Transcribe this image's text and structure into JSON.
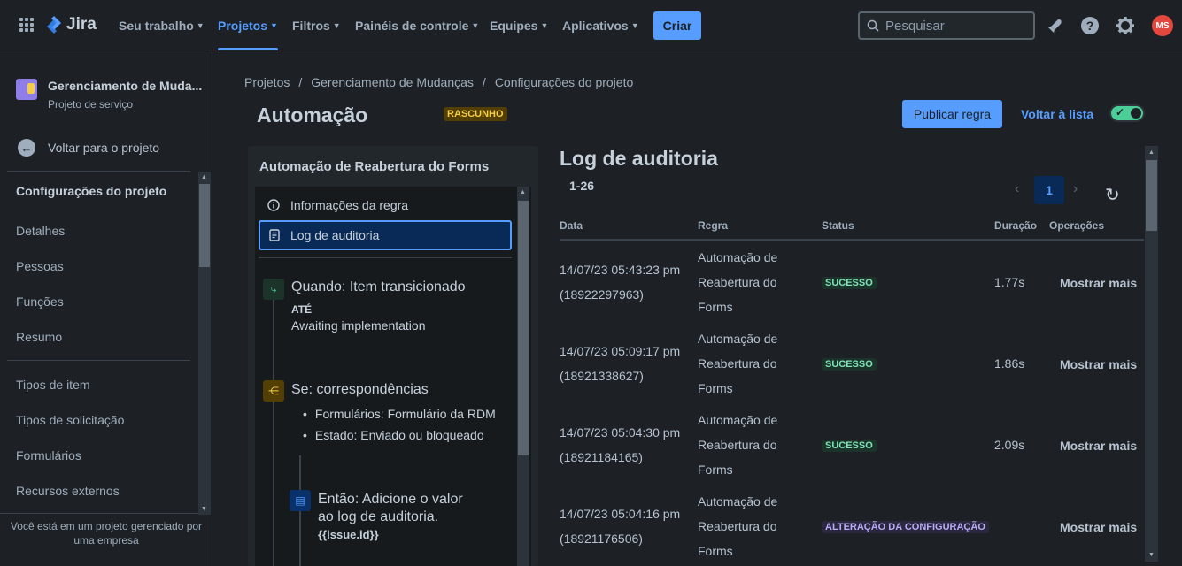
{
  "topbar": {
    "app_name": "Jira",
    "nav": [
      {
        "label": "Seu trabalho"
      },
      {
        "label": "Projetos"
      },
      {
        "label": "Filtros"
      },
      {
        "label": "Painéis de controle"
      },
      {
        "label": "Equipes"
      },
      {
        "label": "Aplicativos"
      }
    ],
    "create_label": "Criar",
    "search_placeholder": "Pesquisar",
    "avatar_initials": "MS",
    "icons": [
      "app-switcher-icon",
      "notifications-icon",
      "help-icon",
      "settings-icon"
    ]
  },
  "sidebar": {
    "project_name": "Gerenciamento de Muda...",
    "project_type": "Projeto de serviço",
    "back_label": "Voltar para o projeto",
    "section_title": "Configurações do projeto",
    "items": [
      "Detalhes",
      "Pessoas",
      "Funções",
      "Resumo",
      "Tipos de item",
      "Tipos de solicitação",
      "Formulários",
      "Recursos externos"
    ],
    "footer": "Você está em um projeto gerenciado por uma empresa"
  },
  "breadcrumb": [
    "Projetos",
    "Gerenciamento de Mudanças",
    "Configurações do projeto"
  ],
  "breadcrumb_sep": "/",
  "page": {
    "title": "Automação",
    "status_badge": "RASCUNHO",
    "publish_label": "Publicar regra",
    "back_to_list": "Voltar à lista",
    "toggle_on": true
  },
  "rule": {
    "name": "Automação de Reabertura do Forms",
    "menu": [
      "Informações da regra",
      "Log de auditoria"
    ],
    "trigger_title": "Quando: Item transicionado",
    "trigger_to_label": "ATÉ",
    "trigger_to_value": "Awaiting implementation",
    "condition_title": "Se: correspondências",
    "condition_items": [
      "Formulários: Formulário da RDM",
      "Estado: Enviado ou bloqueado"
    ],
    "action_title_1": "Então: Adicione o valor",
    "action_title_2": "ao log de auditoria.",
    "action_value": "{{issue.id}}"
  },
  "audit": {
    "title": "Log de auditoria",
    "range": "1-26",
    "current_page": "1",
    "columns": [
      "Data",
      "Regra",
      "Status",
      "Duração",
      "Operações"
    ],
    "rows": [
      {
        "date": "14/07/23 05:43:23 pm",
        "id": "(18922297963)",
        "rule1": "Automação de",
        "rule2": "Reabertura do",
        "rule3": "Forms",
        "status": "SUCESSO",
        "status_kind": "success",
        "duration": "1.77s",
        "action": "Mostrar mais"
      },
      {
        "date": "14/07/23 05:09:17 pm",
        "id": "(18921338627)",
        "rule1": "Automação de",
        "rule2": "Reabertura do",
        "rule3": "Forms",
        "status": "SUCESSO",
        "status_kind": "success",
        "duration": "1.86s",
        "action": "Mostrar mais"
      },
      {
        "date": "14/07/23 05:04:30 pm",
        "id": "(18921184165)",
        "rule1": "Automação de",
        "rule2": "Reabertura do",
        "rule3": "Forms",
        "status": "SUCESSO",
        "status_kind": "success",
        "duration": "2.09s",
        "action": "Mostrar mais"
      },
      {
        "date": "14/07/23 05:04:16 pm",
        "id": "(18921176506)",
        "rule1": "Automação de",
        "rule2": "Reabertura do",
        "rule3": "Forms",
        "status": "ALTERAÇÃO DA CONFIGURAÇÃO",
        "status_kind": "config",
        "duration": "",
        "action": "Mostrar mais"
      }
    ]
  },
  "colors": {
    "accent": "#579dff",
    "background": "#1d2125",
    "success": "#7ee2b8",
    "draft": "#f5cd47",
    "avatar": "#e2483d"
  }
}
